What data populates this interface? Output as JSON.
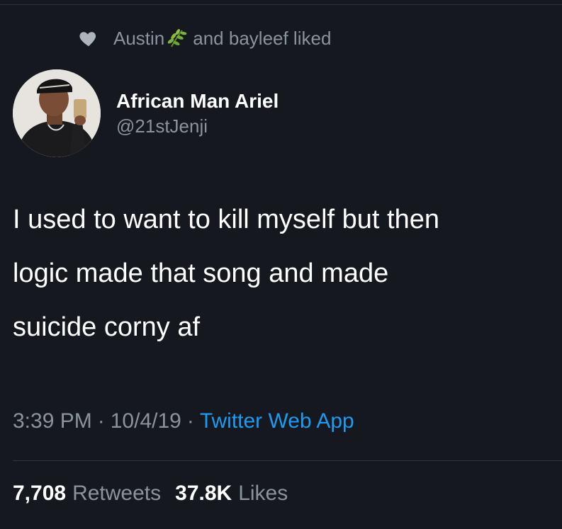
{
  "social_context": {
    "liker_one": "Austin",
    "liker_one_emoji": "herb-icon",
    "rest": "and bayleef liked"
  },
  "author": {
    "display_name": "African Man Ariel",
    "handle": "@21stJenji"
  },
  "tweet": {
    "text": "I used to want to kill myself but then\nlogic made that song and made\nsuicide corny af"
  },
  "meta": {
    "time": "3:39 PM",
    "separator_one": "·",
    "date": "10/4/19",
    "separator_two": "·",
    "source": "Twitter Web App"
  },
  "stats": {
    "retweets_count": "7,708",
    "retweets_label": "Retweets",
    "likes_count": "37.8K",
    "likes_label": "Likes"
  },
  "colors": {
    "background": "#15181f",
    "secondary_text": "#8b939c",
    "link": "#1d9bf0",
    "primary_text": "#ffffff"
  }
}
